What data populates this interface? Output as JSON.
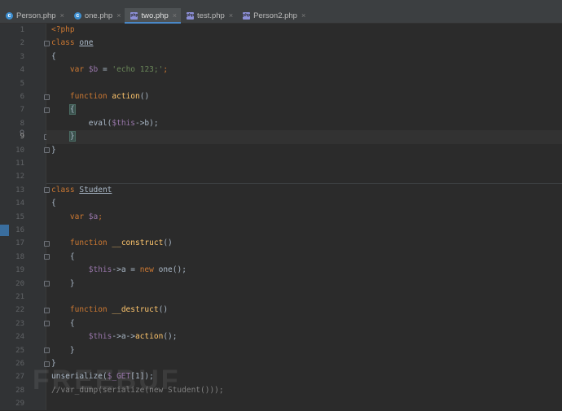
{
  "tabs": [
    {
      "label": "Person.php",
      "icon": "php-class-icon",
      "active": false
    },
    {
      "label": "one.php",
      "icon": "php-class-icon",
      "active": false
    },
    {
      "label": "two.php",
      "icon": "php-file-icon",
      "active": true
    },
    {
      "label": "test.php",
      "icon": "php-file-icon",
      "active": false
    },
    {
      "label": "Person2.php",
      "icon": "php-file-icon",
      "active": false
    }
  ],
  "close_glyph": "×",
  "line_numbers": [
    "1",
    "2",
    "3",
    "4",
    "5",
    "6",
    "7",
    "8",
    "9",
    "10",
    "11",
    "12",
    "13",
    "14",
    "15",
    "16",
    "17",
    "18",
    "19",
    "20",
    "21",
    "22",
    "23",
    "24",
    "25",
    "26",
    "27",
    "28",
    "29"
  ],
  "current_line": "9",
  "code": {
    "l1_open": "<?php",
    "l2_kw": "class",
    "l2_name": "one",
    "l3": "{",
    "l4_kw": "var",
    "l4_var": "$b",
    "l4_eq": " = ",
    "l4_str": "'echo 123;'",
    "l4_end": ";",
    "l6_kw": "function",
    "l6_fn": "action",
    "l6_end": "()",
    "l7": "{",
    "l8_call": "eval(",
    "l8_var": "$this",
    "l8_rest": "->b);",
    "l9": "}",
    "l10": "}",
    "l13_kw": "class",
    "l13_name": "Student",
    "l14": "{",
    "l15_kw": "var",
    "l15_var": "$a",
    "l15_end": ";",
    "l17_kw": "function",
    "l17_fn": "__construct",
    "l17_end": "()",
    "l18": "{",
    "l19_var": "$this",
    "l19_mid": "->a = ",
    "l19_kw": "new",
    "l19_end": " one();",
    "l20": "}",
    "l22_kw": "function",
    "l22_fn": "__destruct",
    "l22_end": "()",
    "l23": "{",
    "l24_var": "$this",
    "l24_mid": "->a->",
    "l24_fn": "action",
    "l24_end": "();",
    "l25": "}",
    "l26": "}",
    "l27_a": "unserialize(",
    "l27_var": "$_GET",
    "l27_b": "[1]);",
    "l28": "//var_dump(serialize(new Student()));"
  },
  "watermark": "FREEBUF",
  "colors": {
    "background": "#2b2b2b",
    "keyword": "#cc7832",
    "variable": "#9876aa",
    "string": "#6a8759",
    "function": "#ffc66d",
    "comment": "#808080",
    "tab_accent": "#4a88c7"
  }
}
